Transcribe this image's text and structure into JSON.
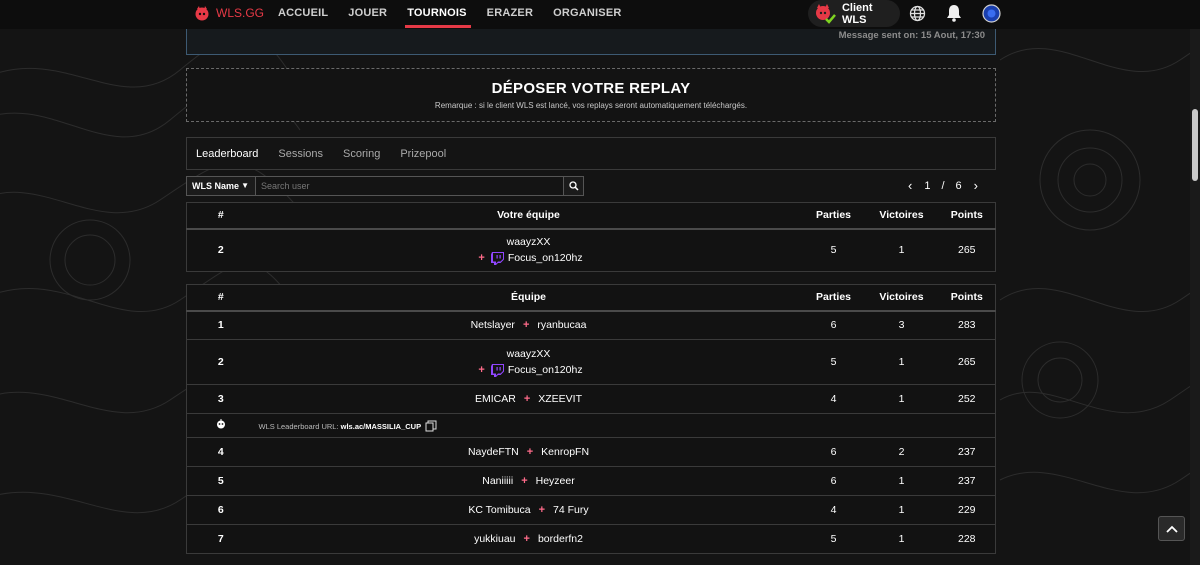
{
  "nav": {
    "brand": "WLS.GG",
    "links": [
      "ACCUEIL",
      "JOUER",
      "TOURNOIS",
      "ERAZER",
      "ORGANISER"
    ],
    "active": "TOURNOIS",
    "client_label": "Client WLS",
    "icons": [
      "globe-icon",
      "bell-icon",
      "avatar-icon"
    ]
  },
  "message": {
    "sent_on": "Message sent on: 15 Aout, 17:30"
  },
  "replay": {
    "title": "DÉPOSER VOTRE REPLAY",
    "note": "Remarque : si le client WLS est lancé, vos replays seront automatiquement téléchargés."
  },
  "tabs": [
    "Leaderboard",
    "Sessions",
    "Scoring",
    "Prizepool"
  ],
  "search": {
    "select_label": "WLS Name",
    "placeholder": "Search user"
  },
  "pager": {
    "current": "1",
    "separator": "/",
    "total": "6"
  },
  "my_team": {
    "headers": {
      "rank": "#",
      "team": "Votre équipe",
      "parties": "Parties",
      "victoires": "Victoires",
      "points": "Points"
    },
    "row": {
      "rank": "2",
      "player1": "waayzXX",
      "player2": "Focus_on120hz",
      "parties": "5",
      "victoires": "1",
      "points": "265"
    }
  },
  "leaderboard": {
    "headers": {
      "rank": "#",
      "team": "Équipe",
      "parties": "Parties",
      "victoires": "Victoires",
      "points": "Points"
    },
    "rows": [
      {
        "rank": "1",
        "player1": "Netslayer",
        "player2": "ryanbucaa",
        "parties": "6",
        "victoires": "3",
        "points": "283"
      },
      {
        "rank": "2",
        "player1": "waayzXX",
        "player2": "Focus_on120hz",
        "parties": "5",
        "victoires": "1",
        "points": "265"
      },
      {
        "rank": "3",
        "player1": "EMICAR",
        "player2": "XZEEVIT",
        "parties": "4",
        "victoires": "1",
        "points": "252"
      },
      {
        "rank": "4",
        "player1": "NaydeFTN",
        "player2": "KenropFN",
        "parties": "6",
        "victoires": "2",
        "points": "237"
      },
      {
        "rank": "5",
        "player1": "Naniiiii",
        "player2": "Heyzeer",
        "parties": "6",
        "victoires": "1",
        "points": "237"
      },
      {
        "rank": "6",
        "player1": "KC Tomibuca",
        "player2": "74 Fury",
        "parties": "4",
        "victoires": "1",
        "points": "229"
      },
      {
        "rank": "7",
        "player1": "yukkiuau",
        "player2": "borderfn2",
        "parties": "5",
        "victoires": "1",
        "points": "228"
      }
    ],
    "url_row": {
      "label": "WLS Leaderboard URL:",
      "url": "wls.ac/MASSILIA_CUP"
    }
  },
  "colors": {
    "accent": "#e63946",
    "plus": "#ff6b8a",
    "twitch": "#9146ff"
  }
}
